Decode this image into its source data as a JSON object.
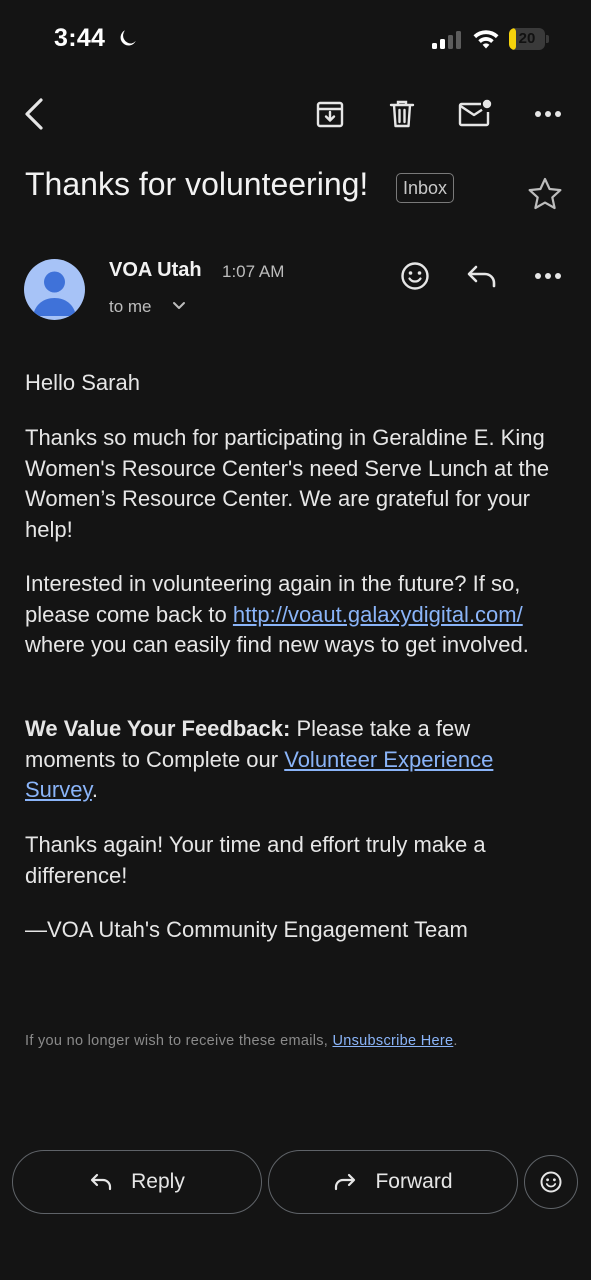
{
  "status_bar": {
    "time": "3:44",
    "battery_level": "20",
    "battery_fraction": 0.2
  },
  "toolbar": {
    "back_icon": "back-arrow-icon",
    "archive_icon": "archive-icon",
    "delete_icon": "trash-icon",
    "mark_unread_icon": "mail-unread-icon",
    "more_icon": "more-horizontal-icon"
  },
  "email": {
    "subject": "Thanks for volunteering!",
    "label": "Inbox",
    "sender": "VOA Utah",
    "time": "1:07 AM",
    "recipient": "to me",
    "greeting": "Hello Sarah",
    "paragraph1": "Thanks so much for participating in Geraldine E. King Women's Resource Center's need Serve Lunch at the Women’s Resource Center. We are grateful for your help!",
    "paragraph2_before": "Interested in volunteering again in the future? If so, please come back to ",
    "paragraph2_link": "http://voaut.galaxydigital.com/",
    "paragraph2_after": " where you can easily find new ways to get involved.",
    "feedback_bold": "We Value Your Feedback:",
    "feedback_text": " Please take a few moments to Complete our ",
    "feedback_link": "Volunteer Experience Survey",
    "feedback_end": ".",
    "paragraph4": "Thanks again! Your time and effort truly make a difference!",
    "signature": "—VOA Utah's Community Engagement Team",
    "footer_text": "If you no longer wish to receive these emails, ",
    "footer_link": "Unsubscribe Here",
    "footer_end": "."
  },
  "actions": {
    "reply_label": "Reply",
    "forward_label": "Forward"
  },
  "colors": {
    "background": "#141414",
    "link": "#8ab4f8",
    "battery": "#f5d20b",
    "avatar": "#a7c3f7"
  }
}
